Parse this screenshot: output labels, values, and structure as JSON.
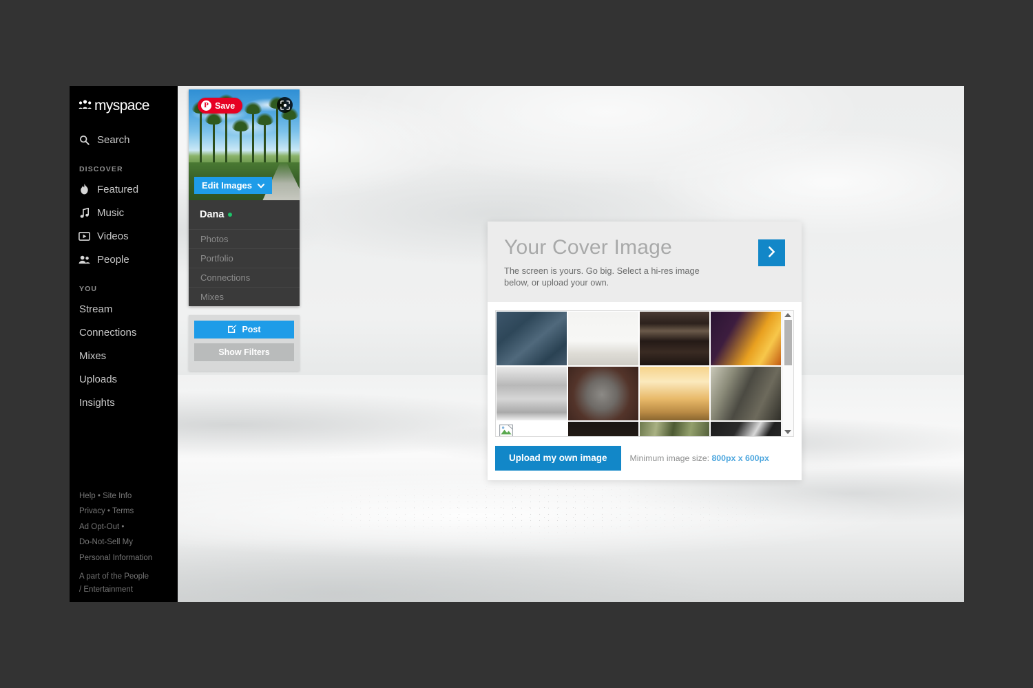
{
  "brand": {
    "name": "myspace",
    "logo_icon": "people-dots-icon"
  },
  "sidebar": {
    "search": {
      "label": "Search",
      "icon": "search-icon"
    },
    "discover_heading": "DISCOVER",
    "discover_items": [
      {
        "label": "Featured",
        "icon": "flame-icon"
      },
      {
        "label": "Music",
        "icon": "music-note-icon"
      },
      {
        "label": "Videos",
        "icon": "video-play-icon"
      },
      {
        "label": "People",
        "icon": "people-icon"
      }
    ],
    "you_heading": "YOU",
    "you_items": [
      {
        "label": "Stream"
      },
      {
        "label": "Connections"
      },
      {
        "label": "Mixes"
      },
      {
        "label": "Uploads"
      },
      {
        "label": "Insights"
      }
    ],
    "footer": {
      "row1": [
        "Help",
        "Site Info"
      ],
      "row2": [
        "Privacy",
        "Terms"
      ],
      "row3": [
        "Ad Opt-Out"
      ],
      "row4_line1": "Do-Not-Sell My",
      "row4_line2": "Personal Information",
      "tagline_line1": "A part of the People",
      "tagline_line2": "/ Entertainment",
      "separator": "•"
    }
  },
  "profile": {
    "pinterest_save": {
      "label": "Save",
      "icon": "pinterest-icon",
      "badge": "P"
    },
    "lens_button": {
      "icon": "lens-search-icon"
    },
    "edit_images": {
      "label": "Edit Images",
      "icon": "chevron-down-icon"
    },
    "name": "Dana",
    "status": "online",
    "links": [
      {
        "label": "Photos"
      },
      {
        "label": "Portfolio"
      },
      {
        "label": "Connections"
      },
      {
        "label": "Mixes"
      }
    ],
    "post_button": {
      "label": "Post",
      "icon": "compose-icon"
    },
    "filters_button": {
      "label": "Show Filters"
    }
  },
  "cover_modal": {
    "title": "Your Cover Image",
    "subtitle": "The screen is yours. Go big. Select a hi-res image below, or upload your own.",
    "next_button": {
      "icon": "chevron-right-icon"
    },
    "upload_button": "Upload my own image",
    "min_size_label": "Minimum image size:",
    "min_size_value": "800px x 600px",
    "scrollbar": {
      "up_icon": "triangle-up-icon",
      "down_icon": "triangle-down-icon"
    },
    "thumbnails": [
      {
        "name": "blue-cloud-texture",
        "css": "linear-gradient(140deg,#3d566b 0%,#2e4759 30%,#50697c 55%,#2a4253 80%,#44596c 100%)"
      },
      {
        "name": "white-snow-landscape",
        "css": "linear-gradient(to bottom,#f4f4f2 0%,#f7f7f5 55%,#dedcd6 78%,#cfcdc6 100%)"
      },
      {
        "name": "dark-workshop-shelf",
        "css": "linear-gradient(to bottom,#4a3a33 0%,#2c211c 22%,#6b5a4a 36%,#241a16 55%,#3a2b23 75%,#1d1512 100%)"
      },
      {
        "name": "fire-sparks-purple",
        "css": "linear-gradient(120deg,#2a1533 0%,#3d1d3f 30%,#e8a020 62%,#f7c74a 78%,#c25a12 100%)"
      },
      {
        "name": "bw-structure-symmetry",
        "css": "linear-gradient(to bottom,#e9e9e9 0%,#b8b8b8 35%,#d6d6d6 60%,#a9a9a9 85%,#efefef 100%)"
      },
      {
        "name": "drumsticks-on-drum",
        "css": "radial-gradient(circle at 48% 52%,#8c8a86 0%,#6e6a66 32%,#53342a 62%,#3b241d 100%)"
      },
      {
        "name": "golden-sunlight-crowd",
        "css": "linear-gradient(to bottom,#f6d48c 0%,#fbe9bd 28%,#e8b969 60%,#b98a44 85%,#8a6630 100%)"
      },
      {
        "name": "industrial-building",
        "css": "linear-gradient(115deg,#c9c8b8 0%,#8a8a78 26%,#4b4a42 48%,#6d6a5c 72%,#2f2e28 100%)"
      },
      {
        "name": "broken-image-placeholder",
        "broken": true
      },
      {
        "name": "dark-doorway-light",
        "css": "linear-gradient(to bottom,#1a1512 0%,#241b15 35%,#e8e0cc 58%,#2b211a 80%,#110d0b 100%)"
      },
      {
        "name": "green-reeds-grass",
        "css": "linear-gradient(100deg,#6e7a4e 0%,#a9b183 22%,#4d5a33 44%,#93a06c 66%,#3f4b2a 100%)"
      },
      {
        "name": "white-lines-dark",
        "css": "linear-gradient(120deg,#1c1c1c 0%,#2a2a2a 30%,#d8d8d8 50%,#1f1f1f 64%,#343434 100%)"
      }
    ]
  }
}
